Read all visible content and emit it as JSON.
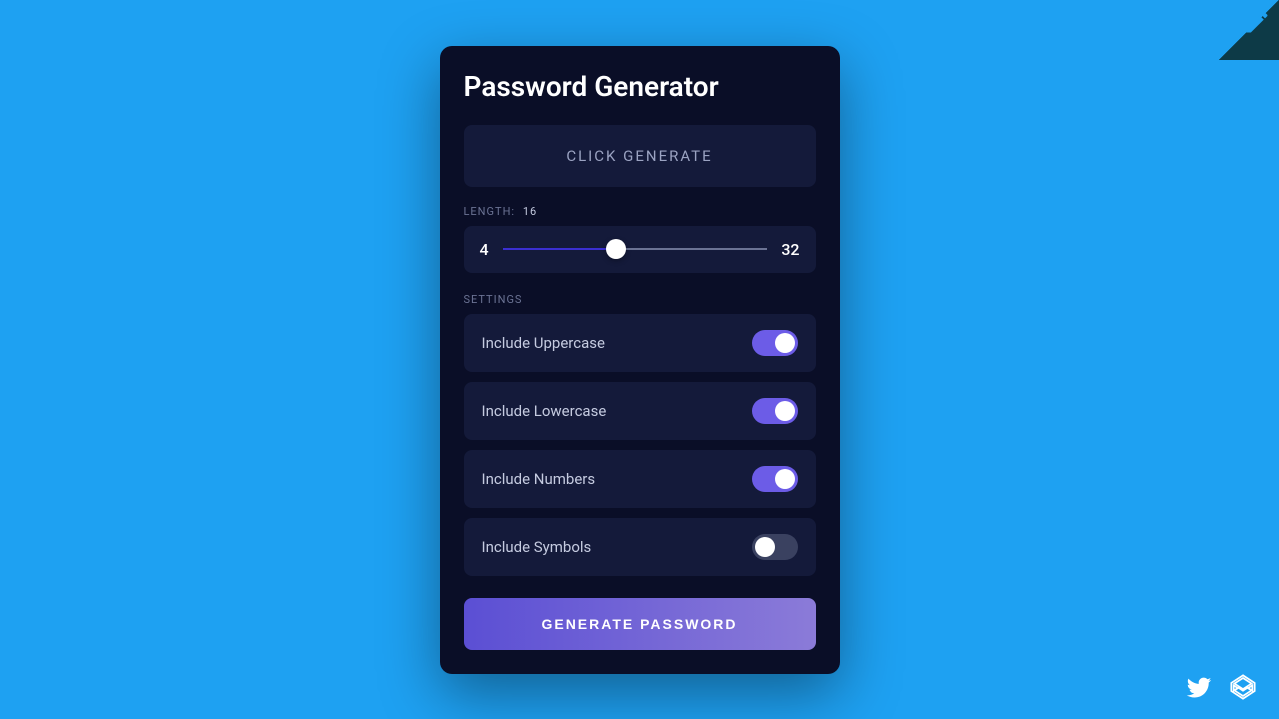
{
  "title": "Password Generator",
  "output": {
    "placeholder": "CLICK GENERATE"
  },
  "length": {
    "label": "LENGTH:",
    "value": "16",
    "min": "4",
    "max": "32"
  },
  "settings": {
    "label": "SETTINGS",
    "items": [
      {
        "label": "Include Uppercase",
        "on": true
      },
      {
        "label": "Include Lowercase",
        "on": true
      },
      {
        "label": "Include Numbers",
        "on": true
      },
      {
        "label": "Include Symbols",
        "on": false
      }
    ]
  },
  "generate_button": "GENERATE PASSWORD"
}
